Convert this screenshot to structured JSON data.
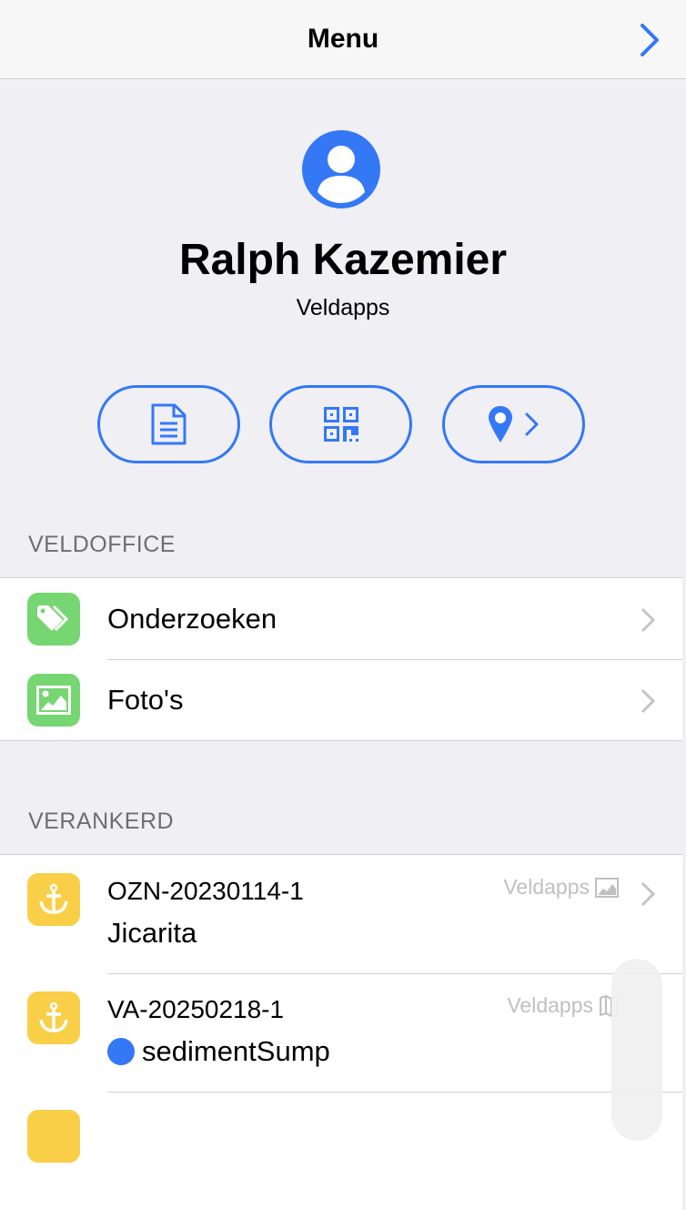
{
  "header": {
    "title": "Menu"
  },
  "profile": {
    "name": "Ralph Kazemier",
    "organization": "Veldapps"
  },
  "actions": [
    {
      "icon": "document-icon"
    },
    {
      "icon": "qr-code-icon"
    },
    {
      "icon": "location-pin-icon"
    }
  ],
  "veldoffice": {
    "header": "VELDOFFICE",
    "items": [
      {
        "label": "Onderzoeken",
        "icon": "tags-icon"
      },
      {
        "label": "Foto's",
        "icon": "photo-icon"
      }
    ]
  },
  "verankerd": {
    "header": "VERANKERD",
    "items": [
      {
        "code": "OZN-20230114-1",
        "title": "Jicarita",
        "source": "Veldapps",
        "source_icon": "photo-icon"
      },
      {
        "code": "VA-20250218-1",
        "title": "sedimentSump",
        "source": "Veldapps",
        "source_icon": "map-icon"
      }
    ]
  },
  "colors": {
    "accent": "#3478f6",
    "green": "#76d672",
    "yellow": "#f9cf47"
  }
}
